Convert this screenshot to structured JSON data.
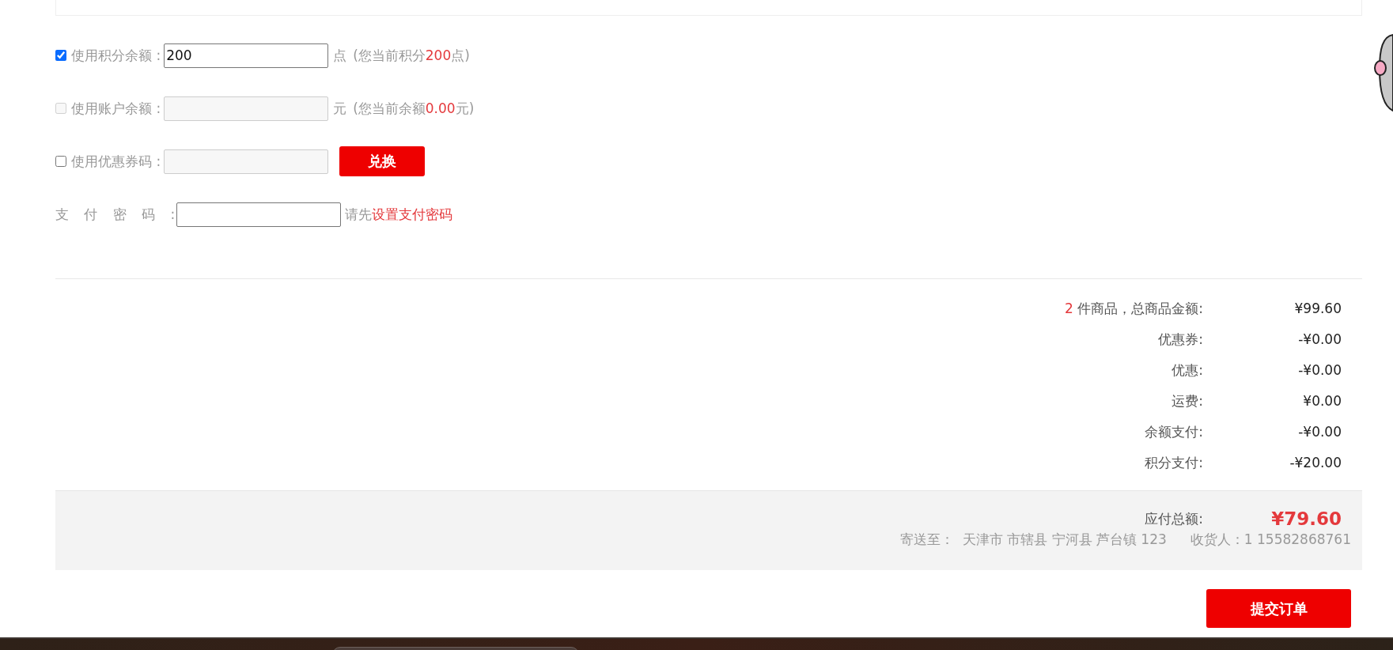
{
  "options": [
    {
      "kind": "checkbox",
      "checked": true,
      "disabled": false,
      "label": "使用积分余额 :",
      "field": {
        "value": "200",
        "disabled": false
      },
      "unit": "点",
      "note_before": "(您当前积分",
      "note_amount": "200",
      "note_after": "点)"
    },
    {
      "kind": "checkbox",
      "checked": false,
      "disabled": true,
      "label": "使用账户余额 :",
      "field": {
        "disabled": true
      },
      "unit": "元",
      "note_before": "(您当前余额",
      "note_amount": "0.00",
      "note_after": "元)"
    },
    {
      "kind": "checkbox",
      "checked": false,
      "disabled": false,
      "label": "使用优惠券码 :",
      "field": {
        "disabled": true
      },
      "button": "兑换"
    },
    {
      "kind": "password",
      "label": "支 付 密 码 :",
      "field": {
        "disabled": false
      },
      "hint": "请先",
      "link": "设置支付密码"
    }
  ],
  "summary": {
    "items": [
      {
        "count": "2",
        "label": "件商品，总商品金额:",
        "value": "¥99.60"
      },
      {
        "label": "优惠券:",
        "value": "-¥0.00"
      },
      {
        "label": "优惠:",
        "value": "-¥0.00"
      },
      {
        "label": "运费:",
        "value": "¥0.00"
      },
      {
        "label": "余额支付:",
        "value": "-¥0.00"
      },
      {
        "label": "积分支付:",
        "value": "-¥20.00"
      }
    ]
  },
  "total": {
    "label": "应付总额:",
    "value": "¥79.60",
    "address": "寄送至：  天津市 市辖县 宁河县 芦台镇 123",
    "receiver": "收货人：1 15582868761"
  },
  "submit_button": "提交订单"
}
